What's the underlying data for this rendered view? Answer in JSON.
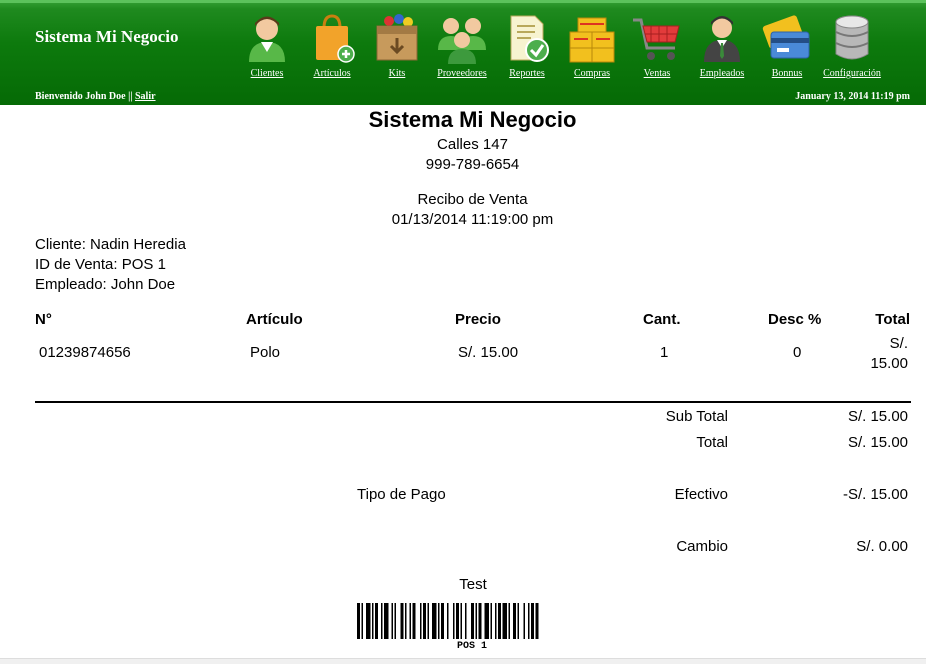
{
  "header": {
    "app_title": "Sistema Mi Negocio",
    "welcome_text": "Bienvenido John Doe ||",
    "logout_label": "Salir",
    "datetime": "January 13, 2014 11:19 pm",
    "nav": [
      {
        "label": "Clientes",
        "icon": "customer-icon"
      },
      {
        "label": "Artículos",
        "icon": "shopping-bag-icon"
      },
      {
        "label": "Kits",
        "icon": "box-icon"
      },
      {
        "label": "Proveedores",
        "icon": "group-icon"
      },
      {
        "label": "Reportes",
        "icon": "document-check-icon"
      },
      {
        "label": "Compras",
        "icon": "boxes-icon"
      },
      {
        "label": "Ventas",
        "icon": "cart-icon"
      },
      {
        "label": "Empleados",
        "icon": "employee-icon"
      },
      {
        "label": "Bonnus",
        "icon": "card-icon"
      },
      {
        "label": "Configuración",
        "icon": "database-icon"
      }
    ]
  },
  "receipt": {
    "company_name": "Sistema Mi Negocio",
    "address": "Calles 147",
    "phone": "999-789-6654",
    "title": "Recibo de Venta",
    "date": "01/13/2014 11:19:00 pm",
    "cliente": "Cliente: Nadin Heredia",
    "venta_id": "ID de Venta: POS 1",
    "empleado": "Empleado: John Doe",
    "columns": {
      "num": "N°",
      "articulo": "Artículo",
      "precio": "Precio",
      "cant": "Cant.",
      "desc": "Desc %",
      "total": "Total"
    },
    "items": [
      {
        "num": "01239874656",
        "articulo": "Polo",
        "precio": "S/. 15.00",
        "cant": "1",
        "desc": "0",
        "total": "S/. 15.00"
      }
    ],
    "subtotal_label": "Sub Total",
    "subtotal_value": "S/. 15.00",
    "total_label": "Total",
    "total_value": "S/. 15.00",
    "payment_type_label": "Tipo de Pago",
    "payment_method": "Efectivo",
    "payment_value": "-S/. 15.00",
    "change_label": "Cambio",
    "change_value": "S/. 0.00",
    "footer_text": "Test",
    "barcode_text": "POS 1"
  }
}
